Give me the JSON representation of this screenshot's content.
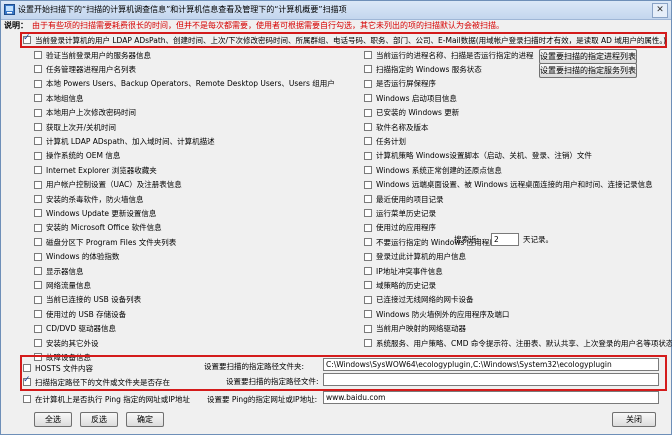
{
  "window": {
    "title": "设置开始扫描下的“扫描的计算机调查信息”和计算机信息查看及管理下的“计算机概要”扫描项",
    "close_label": "✕"
  },
  "notice": {
    "label": "说明：",
    "text": "由于有些项的扫描需要耗费很长的时间，但并不是每次都需要，使用者可根据需要自行勾选，其它未列出的项的扫描默认为会被扫描。"
  },
  "top_option": {
    "label": "当前登录计算机的用户 LDAP ADsPath、创建时间、上次/下次修改密码时间、所属群组、电话号码、职务、部门、公司、E-Mail数据(用域帐户登录扫描时才有效，是读取 AD 域用户的属性。)",
    "checked": true
  },
  "left_items": [
    {
      "label": "验证当前登录用户的服务器信息",
      "checked": false
    },
    {
      "label": "任务管理器进程用户名列表",
      "checked": false
    },
    {
      "label": "本地 Powers Users、Backup Operators、Remote Desktop Users、Users 组用户",
      "checked": false
    },
    {
      "label": "本地组信息",
      "checked": false
    },
    {
      "label": "本地用户上次修改密码时间",
      "checked": false
    },
    {
      "label": "获取上次开/关机时间",
      "checked": false
    },
    {
      "label": "计算机 LDAP ADspath、加入域时间、计算机描述",
      "checked": false
    },
    {
      "label": "操作系统的 OEM 信息",
      "checked": false
    },
    {
      "label": "Internet Explorer 浏览器收藏夹",
      "checked": false
    },
    {
      "label": "用户帐户控制设置（UAC）及注册表信息",
      "checked": false
    },
    {
      "label": "安装的杀毒软件，防火墙信息",
      "checked": false
    },
    {
      "label": "Windows Update 更新设置信息",
      "checked": false
    },
    {
      "label": "安装的 Microsoft Office 软件信息",
      "checked": false
    },
    {
      "label": "磁盘分区下 Program Files 文件夹列表",
      "checked": false
    },
    {
      "label": "Windows 的体验指数",
      "checked": false
    },
    {
      "label": "显示器信息",
      "checked": false
    },
    {
      "label": "网络流量信息",
      "checked": false
    },
    {
      "label": "当前已连接的 USB 设备列表",
      "checked": false
    },
    {
      "label": "使用过的 USB 存储设备",
      "checked": false
    },
    {
      "label": "CD/DVD 驱动器信息",
      "checked": false
    },
    {
      "label": "安装的其它外设",
      "checked": false
    },
    {
      "label": "故障设备信息",
      "checked": false
    }
  ],
  "right_items": [
    {
      "label": "当前运行的进程名称、扫描是否运行指定的进程",
      "checked": false
    },
    {
      "label": "扫描指定的 Windows 服务状态",
      "checked": false
    },
    {
      "label": "是否运行屏保程序",
      "checked": false
    },
    {
      "label": "Windows 启动项目信息",
      "checked": false
    },
    {
      "label": "已安装的 Windows 更新",
      "checked": false
    },
    {
      "label": "软件名称及版本",
      "checked": false
    },
    {
      "label": "任务计划",
      "checked": false
    },
    {
      "label": "计算机策略 Windows设置脚本（启动、关机、登录、注销）文件",
      "checked": false
    },
    {
      "label": "Windows 系统正常创建的还原点信息",
      "checked": false
    },
    {
      "label": "Windows 远端桌面设置、被 Windows 远程桌面连接的用户和时间、连接记录信息",
      "checked": false
    },
    {
      "label": "最近使用的项目记录",
      "checked": false
    },
    {
      "label": "运行菜单历史记录",
      "checked": false
    },
    {
      "label": "使用过的应用程序",
      "checked": false
    },
    {
      "label": "不要运行指定的 Windows 应用程序列表",
      "checked": false
    },
    {
      "label": "登录过此计算机的用户信息",
      "checked": false
    },
    {
      "label": "IP地址冲突事件信息",
      "checked": false
    },
    {
      "label": "域策略的历史记录",
      "checked": false
    },
    {
      "label": "已连接过无线网络的网卡设备",
      "checked": false
    },
    {
      "label": "Windows 防火墙例外的应用程序及端口",
      "checked": false
    },
    {
      "label": "当前用户映射的网络驱动器",
      "checked": false
    },
    {
      "label": "系统服务、用户策略、CMD 命令提示符、注册表、默认共享、上次登录的用户名等项状态",
      "checked": false
    }
  ],
  "buttons": {
    "process_list": "设置要扫描的指定进程列表",
    "service_list": "设置要扫描的指定服务列表",
    "select_all": "全选",
    "invert": "反选",
    "ok": "确定",
    "close": "关闭"
  },
  "conflict": {
    "days_label": "搜索近:",
    "days_value": "2",
    "days_suffix": "天记录。"
  },
  "hosts_option": {
    "label": "HOSTS 文件内容",
    "checked": false
  },
  "scan_folder_option": {
    "label": "扫描指定路径下的文件或文件夹是否存在",
    "checked": true
  },
  "folder_path": {
    "label": "设置要扫描的指定路径文件夹:",
    "value": "C:\\Windows\\SysWOW64\\ecologyplugin,C:\\Windows\\System32\\ecologyplugin"
  },
  "file_path": {
    "label": "设置要扫描的指定路径文件:",
    "value": ""
  },
  "ping_option": {
    "label": "在计算机上是否执行 Ping 指定的网址或IP地址",
    "checked": false
  },
  "ping_target": {
    "label": "设置要 Ping的指定网址或IP地址:",
    "value": "www.baidu.com"
  }
}
